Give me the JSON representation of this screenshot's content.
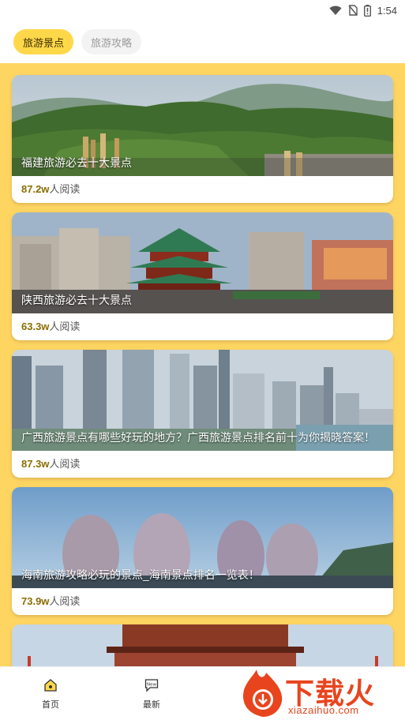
{
  "status_bar": {
    "time": "1:54",
    "icons": [
      "wifi-icon",
      "no-sim-icon",
      "battery-icon"
    ]
  },
  "tabs": [
    {
      "label": "旅游景点",
      "active": true
    },
    {
      "label": "旅游攻略",
      "active": false
    }
  ],
  "articles": [
    {
      "title": "福建旅游必去十大景点",
      "reads_count": "87.2w",
      "reads_suffix": "人阅读"
    },
    {
      "title": "陕西旅游必去十大景点",
      "reads_count": "63.3w",
      "reads_suffix": "人阅读"
    },
    {
      "title": "广西旅游景点有哪些好玩的地方？广西旅游景点排名前十为你揭晓答案！",
      "reads_count": "87.3w",
      "reads_suffix": "人阅读"
    },
    {
      "title": "海南旅游攻略必玩的景点_海南景点排名一览表！",
      "reads_count": "73.9w",
      "reads_suffix": "人阅读"
    }
  ],
  "bottom_nav": {
    "items": [
      {
        "label": "首页",
        "icon": "home-icon"
      },
      {
        "label": "最新",
        "icon": "new-badge-icon"
      }
    ]
  },
  "watermark": {
    "text": "下载火",
    "url": "xiazaihuo.com"
  },
  "colors": {
    "accent": "#ffd84a",
    "feed_background": "#ffd562",
    "reads_count": "#8a6d00",
    "watermark": "#e8451e"
  }
}
